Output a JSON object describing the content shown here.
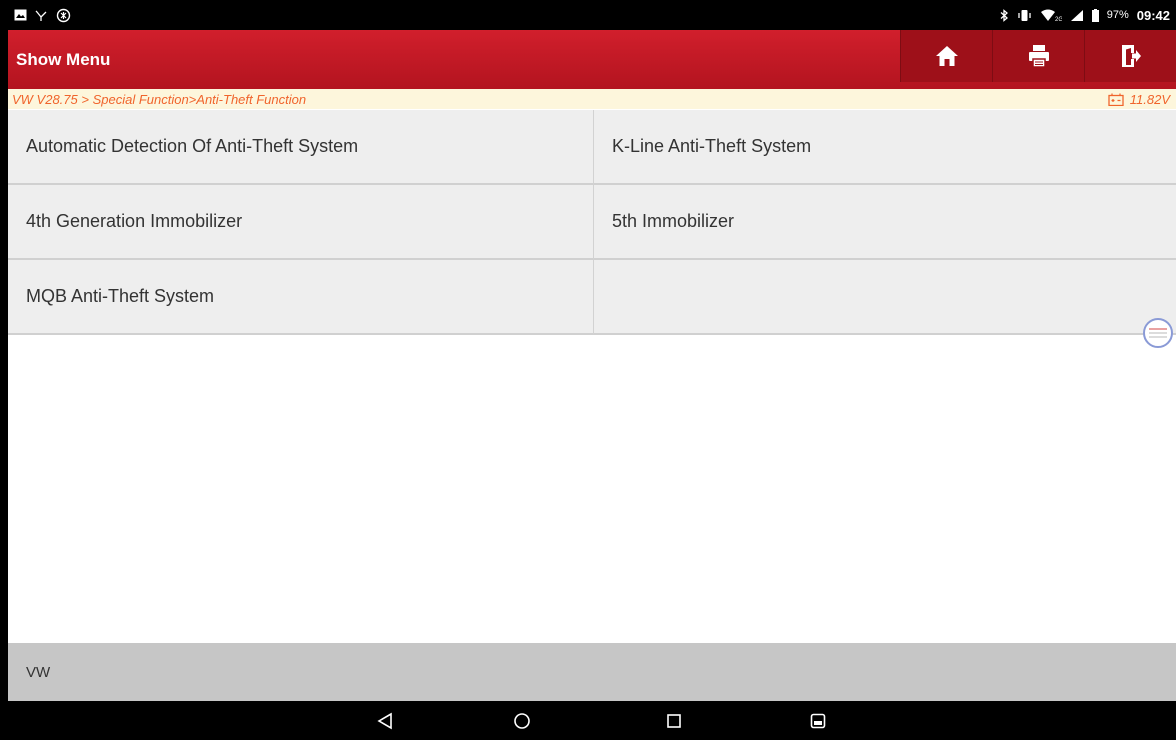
{
  "status_bar": {
    "left_icons": [
      "gallery-notification-icon",
      "usb-debug-icon",
      "settings-badge-icon"
    ],
    "right_icons": [
      "bluetooth-icon",
      "vibrate-icon",
      "wifi-icon",
      "signal-icon",
      "battery-icon"
    ],
    "battery_text": "97%",
    "time": "09:42"
  },
  "header": {
    "title": "Show Menu",
    "buttons": [
      "home",
      "print",
      "exit"
    ],
    "accent_color": "#c8161f"
  },
  "breadcrumb": {
    "path": "VW V28.75 > Special Function>Anti-Theft Function",
    "voltage": "11.82V",
    "color": "#f0642c"
  },
  "menu": {
    "items": [
      "Automatic Detection Of Anti-Theft System",
      "K-Line Anti-Theft System",
      "4th Generation Immobilizer",
      "5th Immobilizer",
      "MQB Anti-Theft System",
      ""
    ]
  },
  "footer": {
    "label": "VW"
  },
  "nav": {
    "buttons": [
      "back",
      "home",
      "recents",
      "screenshot"
    ]
  }
}
